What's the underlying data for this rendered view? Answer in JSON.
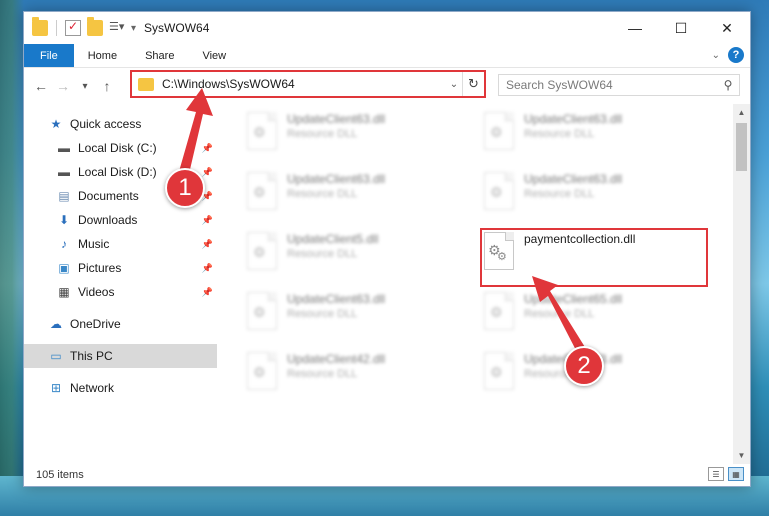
{
  "window": {
    "title": "SysWOW64"
  },
  "ribbon": {
    "tabs": [
      "File",
      "Home",
      "Share",
      "View"
    ],
    "help": "?"
  },
  "address": {
    "path": "C:\\Windows\\SysWOW64"
  },
  "search": {
    "placeholder": "Search SysWOW64"
  },
  "sidebar": {
    "items": [
      {
        "label": "Quick access",
        "icon": "star-icon"
      },
      {
        "label": "Local Disk (C:)",
        "icon": "drive-icon",
        "pinned": true
      },
      {
        "label": "Local Disk (D:)",
        "icon": "drive-icon",
        "pinned": true
      },
      {
        "label": "Documents",
        "icon": "documents-icon",
        "pinned": true
      },
      {
        "label": "Downloads",
        "icon": "download-icon",
        "pinned": true
      },
      {
        "label": "Music",
        "icon": "music-icon",
        "pinned": true
      },
      {
        "label": "Pictures",
        "icon": "pictures-icon",
        "pinned": true
      },
      {
        "label": "Videos",
        "icon": "videos-icon",
        "pinned": true
      },
      {
        "label": "OneDrive",
        "icon": "cloud-icon"
      },
      {
        "label": "This PC",
        "icon": "computer-icon",
        "selected": true
      },
      {
        "label": "Network",
        "icon": "network-icon"
      }
    ]
  },
  "files": [
    {
      "name": "UpdateClient63.dll",
      "type": "Resource DLL"
    },
    {
      "name": "UpdateClient63.dll",
      "type": "Resource DLL"
    },
    {
      "name": "UpdateClient63.dll",
      "type": "Resource DLL"
    },
    {
      "name": "UpdateClient63.dll",
      "type": "Resource DLL"
    },
    {
      "name": "UpdateClient5.dll",
      "type": "Resource DLL"
    },
    {
      "name": "paymentcollection.dll",
      "type": ""
    },
    {
      "name": "UpdateClient63.dll",
      "type": "Resource DLL"
    },
    {
      "name": "UpdateClient65.dll",
      "type": "Resource DLL"
    },
    {
      "name": "UpdateClient42.dll",
      "type": "Resource DLL"
    },
    {
      "name": "UpdateClient63.dll",
      "type": "Resource DLL"
    }
  ],
  "status": {
    "item_count": "105 items"
  },
  "markers": [
    "1",
    "2"
  ],
  "colors": {
    "accent": "#1979ca",
    "highlight": "#e0363a"
  }
}
